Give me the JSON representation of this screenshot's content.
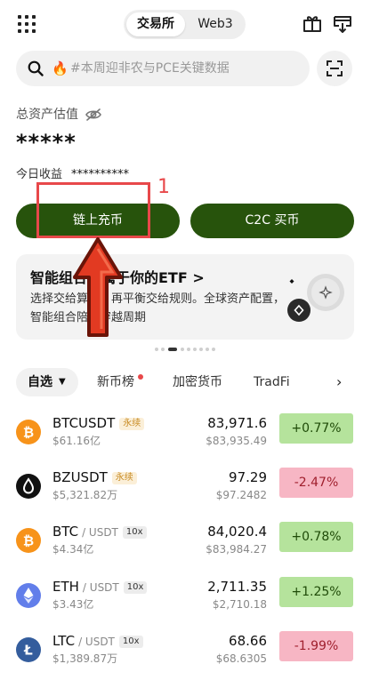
{
  "header": {
    "tabs": [
      {
        "label": "交易所",
        "active": true
      },
      {
        "label": "Web3",
        "active": false
      }
    ],
    "icons": [
      "grid-icon",
      "gift-icon",
      "download-icon"
    ]
  },
  "search": {
    "placeholder": "#本周迎非农与PCE关键数据",
    "icon": "fire-icon"
  },
  "assets": {
    "label": "总资产估值",
    "value": "*****",
    "pnl_label": "今日收益",
    "pnl_value": "**********"
  },
  "actions": {
    "deposit": "链上充币",
    "c2c": "C2C 买币"
  },
  "annotation": {
    "number": "1"
  },
  "banner": {
    "title": "智能组合：属于你的ETF >",
    "desc": "选择交给算法，再平衡交给规则。全球资产配置，智能组合陪你穿越周期"
  },
  "market_tabs": {
    "items": [
      "自选",
      "新币榜",
      "加密货币",
      "TradFi"
    ],
    "active_caret": "▼",
    "next": "›"
  },
  "colors": {
    "brand_green": "#27530c",
    "up_bg": "#b5e39c",
    "down_bg": "#f7b6c4",
    "annotation_red": "#e8484a"
  },
  "list": [
    {
      "symbol": "BTCUSDT",
      "quote": "",
      "tag": "永续",
      "tag_type": "perp",
      "volume": "$61.16亿",
      "price": "83,971.6",
      "price_usd": "$83,935.49",
      "change": "+0.77%",
      "dir": "up",
      "icon": "btc-icon",
      "icon_color": "#f7931a",
      "glyph": "₿"
    },
    {
      "symbol": "BZUSDT",
      "quote": "",
      "tag": "永续",
      "tag_type": "perp",
      "volume": "$5,321.82万",
      "price": "97.29",
      "price_usd": "$97.2482",
      "change": "-2.47%",
      "dir": "down",
      "icon": "oil-drop-icon",
      "icon_color": "#111111",
      "glyph": ""
    },
    {
      "symbol": "BTC",
      "quote": "/ USDT",
      "tag": "10x",
      "tag_type": "lev",
      "volume": "$4.34亿",
      "price": "84,020.4",
      "price_usd": "$83,984.27",
      "change": "+0.78%",
      "dir": "up",
      "icon": "btc-icon",
      "icon_color": "#f7931a",
      "glyph": "₿"
    },
    {
      "symbol": "ETH",
      "quote": "/ USDT",
      "tag": "10x",
      "tag_type": "lev",
      "volume": "$3.43亿",
      "price": "2,711.35",
      "price_usd": "$2,710.18",
      "change": "+1.25%",
      "dir": "up",
      "icon": "eth-icon",
      "icon_color": "#627eea",
      "glyph": ""
    },
    {
      "symbol": "LTC",
      "quote": "/ USDT",
      "tag": "10x",
      "tag_type": "lev",
      "volume": "$1,389.87万",
      "price": "68.66",
      "price_usd": "$68.6305",
      "change": "-1.99%",
      "dir": "down",
      "icon": "ltc-icon",
      "icon_color": "#345d9d",
      "glyph": "Ł"
    }
  ]
}
